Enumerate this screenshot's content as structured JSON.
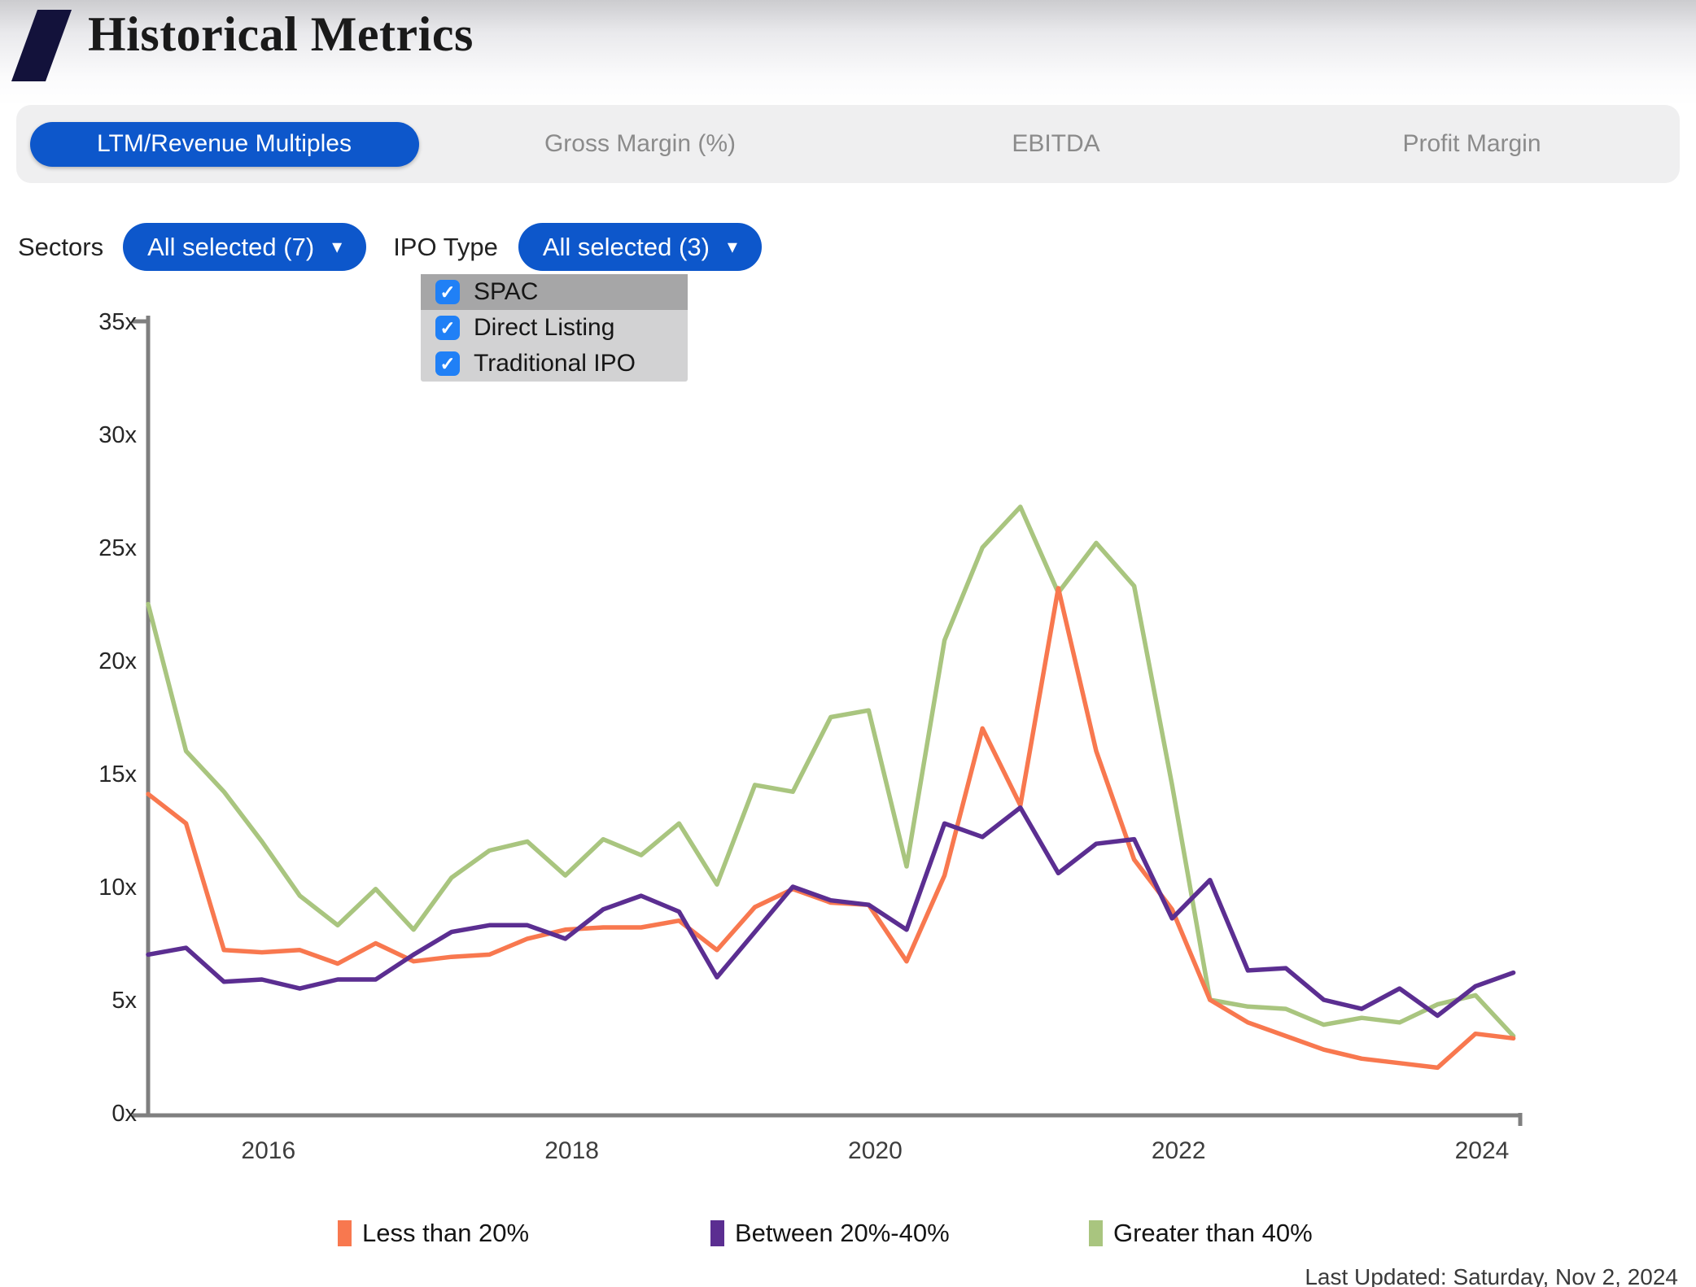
{
  "header": {
    "title": "Historical Metrics"
  },
  "tabs": [
    {
      "label": "LTM/Revenue Multiples",
      "active": true
    },
    {
      "label": "Gross Margin (%)",
      "active": false
    },
    {
      "label": "EBITDA",
      "active": false
    },
    {
      "label": "Profit Margin",
      "active": false
    }
  ],
  "filters": {
    "sectors_label": "Sectors",
    "sectors_value": "All selected (7)",
    "ipo_type_label": "IPO Type",
    "ipo_type_value": "All selected (3)",
    "caret": "▾"
  },
  "dropdown": {
    "items": [
      {
        "label": "SPAC",
        "checked": true,
        "highlighted": true
      },
      {
        "label": "Direct Listing",
        "checked": true,
        "highlighted": false
      },
      {
        "label": "Traditional IPO",
        "checked": true,
        "highlighted": false
      }
    ],
    "check_glyph": "✓"
  },
  "colors": {
    "accent_blue": "#0d57cb",
    "checkbox_blue": "#2080f6",
    "logo_navy": "#13123b",
    "axis_gray": "#7f7f7f",
    "orange": "#f8784f",
    "purple": "#5b2e91",
    "green": "#a9c57f"
  },
  "footer": {
    "last_updated": "Last Updated: Saturday, Nov 2, 2024"
  },
  "chart_data": {
    "type": "line",
    "title": "",
    "xlabel": "",
    "ylabel": "",
    "ylim": [
      0,
      35
    ],
    "grid": false,
    "legend_position": "bottom",
    "y_tick_labels": [
      "0x",
      "5x",
      "10x",
      "15x",
      "20x",
      "25x",
      "30x",
      "35x"
    ],
    "y_tick_values": [
      0,
      5,
      10,
      15,
      20,
      25,
      30,
      35
    ],
    "x_tick_labels": [
      "2016",
      "2018",
      "2020",
      "2022",
      "2024"
    ],
    "x_tick_quarter_index": [
      3,
      11,
      19,
      27,
      35
    ],
    "x": [
      "2015 Q2",
      "2015 Q3",
      "2015 Q4",
      "2016 Q1",
      "2016 Q2",
      "2016 Q3",
      "2016 Q4",
      "2017 Q1",
      "2017 Q2",
      "2017 Q3",
      "2017 Q4",
      "2018 Q1",
      "2018 Q2",
      "2018 Q3",
      "2018 Q4",
      "2019 Q1",
      "2019 Q2",
      "2019 Q3",
      "2019 Q4",
      "2020 Q1",
      "2020 Q2",
      "2020 Q3",
      "2020 Q4",
      "2021 Q1",
      "2021 Q2",
      "2021 Q3",
      "2021 Q4",
      "2022 Q1",
      "2022 Q2",
      "2022 Q3",
      "2022 Q4",
      "2023 Q1",
      "2023 Q2",
      "2023 Q3",
      "2023 Q4",
      "2024 Q1",
      "2024 Q2"
    ],
    "series": [
      {
        "name": "Greater than 40%",
        "color": "#a9c57f",
        "values": [
          22.5,
          16.0,
          14.2,
          12.0,
          9.6,
          8.3,
          9.9,
          8.1,
          10.4,
          11.6,
          12.0,
          10.5,
          12.1,
          11.4,
          12.8,
          10.1,
          14.5,
          14.2,
          17.5,
          17.8,
          10.9,
          20.9,
          25.0,
          26.8,
          23.0,
          25.2,
          23.3,
          14.5,
          5.0,
          4.7,
          4.6,
          3.9,
          4.2,
          4.0,
          4.8,
          5.2,
          3.4
        ]
      },
      {
        "name": "Less than 20%",
        "color": "#f8784f",
        "values": [
          14.1,
          12.8,
          7.2,
          7.1,
          7.2,
          6.6,
          7.5,
          6.7,
          6.9,
          7.0,
          7.7,
          8.1,
          8.2,
          8.2,
          8.5,
          7.2,
          9.1,
          9.9,
          9.3,
          9.2,
          6.7,
          10.5,
          17.0,
          13.6,
          23.2,
          16.0,
          11.2,
          9.0,
          5.0,
          4.0,
          3.4,
          2.8,
          2.4,
          2.2,
          2.0,
          3.5,
          3.3
        ]
      },
      {
        "name": "Between 20%-40%",
        "color": "#5b2e91",
        "values": [
          7.0,
          7.3,
          5.8,
          5.9,
          5.5,
          5.9,
          5.9,
          7.0,
          8.0,
          8.3,
          8.3,
          7.7,
          9.0,
          9.6,
          8.9,
          6.0,
          8.0,
          10.0,
          9.4,
          9.2,
          8.1,
          12.8,
          12.2,
          13.5,
          10.6,
          11.9,
          12.1,
          8.6,
          10.3,
          6.3,
          6.4,
          5.0,
          4.6,
          5.5,
          4.3,
          5.6,
          6.2
        ]
      }
    ],
    "legend_order": [
      "Less than 20%",
      "Between 20%-40%",
      "Greater than 40%"
    ]
  }
}
